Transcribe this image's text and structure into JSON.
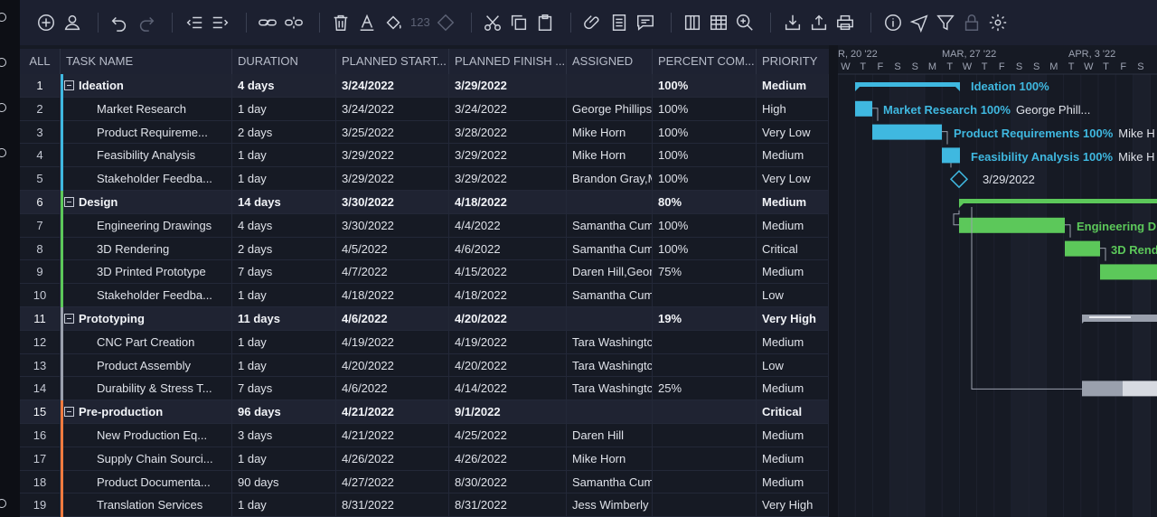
{
  "toolbar": {
    "icons": [
      "add-icon",
      "user-icon",
      "undo-icon",
      "redo-icon",
      "outdent-icon",
      "indent-icon",
      "link-icon",
      "unlink-icon",
      "trash-icon",
      "font-color-icon",
      "fill-color-icon",
      "number-format",
      "diamond-icon",
      "cut-icon",
      "copy-icon",
      "paste-icon",
      "attachment-icon",
      "notes-icon",
      "comment-icon",
      "columns-icon",
      "grid-icon",
      "zoom-icon",
      "import-icon",
      "export-icon",
      "print-icon",
      "info-icon",
      "send-icon",
      "filter-icon",
      "lock-icon",
      "settings-icon"
    ],
    "number_label": "123"
  },
  "columns": {
    "all": "ALL",
    "task": "TASK NAME",
    "duration": "DURATION",
    "start": "PLANNED START...",
    "finish": "PLANNED FINISH ...",
    "assigned": "ASSIGNED",
    "percent": "PERCENT COM...",
    "priority": "PRIORITY"
  },
  "rows": [
    {
      "n": "1",
      "name": "Ideation",
      "dur": "4 days",
      "start": "3/24/2022",
      "finish": "3/29/2022",
      "assigned": "",
      "pct": "100%",
      "pri": "Medium",
      "parent": true,
      "color": "#3fb8e0"
    },
    {
      "n": "2",
      "name": "Market Research",
      "dur": "1 day",
      "start": "3/24/2022",
      "finish": "3/24/2022",
      "assigned": "George Phillips",
      "pct": "100%",
      "pri": "High",
      "parent": false,
      "color": "#3fb8e0"
    },
    {
      "n": "3",
      "name": "Product Requireme...",
      "dur": "2 days",
      "start": "3/25/2022",
      "finish": "3/28/2022",
      "assigned": "Mike Horn",
      "pct": "100%",
      "pri": "Very Low",
      "parent": false,
      "color": "#3fb8e0"
    },
    {
      "n": "4",
      "name": "Feasibility Analysis",
      "dur": "1 day",
      "start": "3/29/2022",
      "finish": "3/29/2022",
      "assigned": "Mike Horn",
      "pct": "100%",
      "pri": "Medium",
      "parent": false,
      "color": "#3fb8e0"
    },
    {
      "n": "5",
      "name": "Stakeholder Feedba...",
      "dur": "1 day",
      "start": "3/29/2022",
      "finish": "3/29/2022",
      "assigned": "Brandon Gray,M",
      "pct": "100%",
      "pri": "Very Low",
      "parent": false,
      "color": "#3fb8e0"
    },
    {
      "n": "6",
      "name": "Design",
      "dur": "14 days",
      "start": "3/30/2022",
      "finish": "4/18/2022",
      "assigned": "",
      "pct": "80%",
      "pri": "Medium",
      "parent": true,
      "color": "#5cc85a"
    },
    {
      "n": "7",
      "name": "Engineering Drawings",
      "dur": "4 days",
      "start": "3/30/2022",
      "finish": "4/4/2022",
      "assigned": "Samantha Cum",
      "pct": "100%",
      "pri": "Medium",
      "parent": false,
      "color": "#5cc85a"
    },
    {
      "n": "8",
      "name": "3D Rendering",
      "dur": "2 days",
      "start": "4/5/2022",
      "finish": "4/6/2022",
      "assigned": "Samantha Cum",
      "pct": "100%",
      "pri": "Critical",
      "parent": false,
      "color": "#5cc85a"
    },
    {
      "n": "9",
      "name": "3D Printed Prototype",
      "dur": "7 days",
      "start": "4/7/2022",
      "finish": "4/15/2022",
      "assigned": "Daren Hill,Geor",
      "pct": "75%",
      "pri": "Medium",
      "parent": false,
      "color": "#5cc85a"
    },
    {
      "n": "10",
      "name": "Stakeholder Feedba...",
      "dur": "1 day",
      "start": "4/18/2022",
      "finish": "4/18/2022",
      "assigned": "Samantha Cum",
      "pct": "",
      "pri": "Low",
      "parent": false,
      "color": "#5cc85a"
    },
    {
      "n": "11",
      "name": "Prototyping",
      "dur": "11 days",
      "start": "4/6/2022",
      "finish": "4/20/2022",
      "assigned": "",
      "pct": "19%",
      "pri": "Very High",
      "parent": true,
      "color": "#9aa0ad"
    },
    {
      "n": "12",
      "name": "CNC Part Creation",
      "dur": "1 day",
      "start": "4/19/2022",
      "finish": "4/19/2022",
      "assigned": "Tara Washingtc",
      "pct": "",
      "pri": "Medium",
      "parent": false,
      "color": "#9aa0ad"
    },
    {
      "n": "13",
      "name": "Product Assembly",
      "dur": "1 day",
      "start": "4/20/2022",
      "finish": "4/20/2022",
      "assigned": "Tara Washingtc",
      "pct": "",
      "pri": "Low",
      "parent": false,
      "color": "#9aa0ad"
    },
    {
      "n": "14",
      "name": "Durability & Stress T...",
      "dur": "7 days",
      "start": "4/6/2022",
      "finish": "4/14/2022",
      "assigned": "Tara Washingtc",
      "pct": "25%",
      "pri": "Medium",
      "parent": false,
      "color": "#9aa0ad"
    },
    {
      "n": "15",
      "name": "Pre-production",
      "dur": "96 days",
      "start": "4/21/2022",
      "finish": "9/1/2022",
      "assigned": "",
      "pct": "",
      "pri": "Critical",
      "parent": true,
      "color": "#f07b3f"
    },
    {
      "n": "16",
      "name": "New Production Eq...",
      "dur": "3 days",
      "start": "4/21/2022",
      "finish": "4/25/2022",
      "assigned": "Daren Hill",
      "pct": "",
      "pri": "Medium",
      "parent": false,
      "color": "#f07b3f"
    },
    {
      "n": "17",
      "name": "Supply Chain Sourci...",
      "dur": "1 day",
      "start": "4/26/2022",
      "finish": "4/26/2022",
      "assigned": "Mike Horn",
      "pct": "",
      "pri": "Medium",
      "parent": false,
      "color": "#f07b3f"
    },
    {
      "n": "18",
      "name": "Product Documenta...",
      "dur": "90 days",
      "start": "4/27/2022",
      "finish": "8/30/2022",
      "assigned": "Samantha Cum",
      "pct": "",
      "pri": "Medium",
      "parent": false,
      "color": "#f07b3f"
    },
    {
      "n": "19",
      "name": "Translation Services",
      "dur": "1 day",
      "start": "8/31/2022",
      "finish": "8/31/2022",
      "assigned": "Jess Wimberly",
      "pct": "",
      "pri": "Very High",
      "parent": false,
      "color": "#f07b3f"
    }
  ],
  "gantt": {
    "weeks": [
      "R, 20 '22",
      "MAR, 27 '22",
      "APR, 3 '22"
    ],
    "days": [
      "W",
      "T",
      "F",
      "S",
      "S",
      "M",
      "T",
      "W",
      "T",
      "F",
      "S",
      "S",
      "M",
      "T",
      "W",
      "T",
      "F",
      "S"
    ],
    "labels": {
      "ideation": "Ideation",
      "ideation_pct": "100%",
      "market": "Market Research",
      "market_pct": "100%",
      "market_who": "George Phill...",
      "requirements": "Product Requirements",
      "requirements_pct": "100%",
      "requirements_who": "Mike H",
      "feasibility": "Feasibility Analysis",
      "feasibility_pct": "100%",
      "feasibility_who": "Mike H",
      "milestone_date": "3/29/2022",
      "engineering": "Engineering D",
      "rendering": "3D Rend"
    },
    "colors": {
      "blue": "#3fb8e0",
      "green": "#5cc85a",
      "gray": "#9aa0ad",
      "grayLight": "#d7dae1"
    }
  }
}
